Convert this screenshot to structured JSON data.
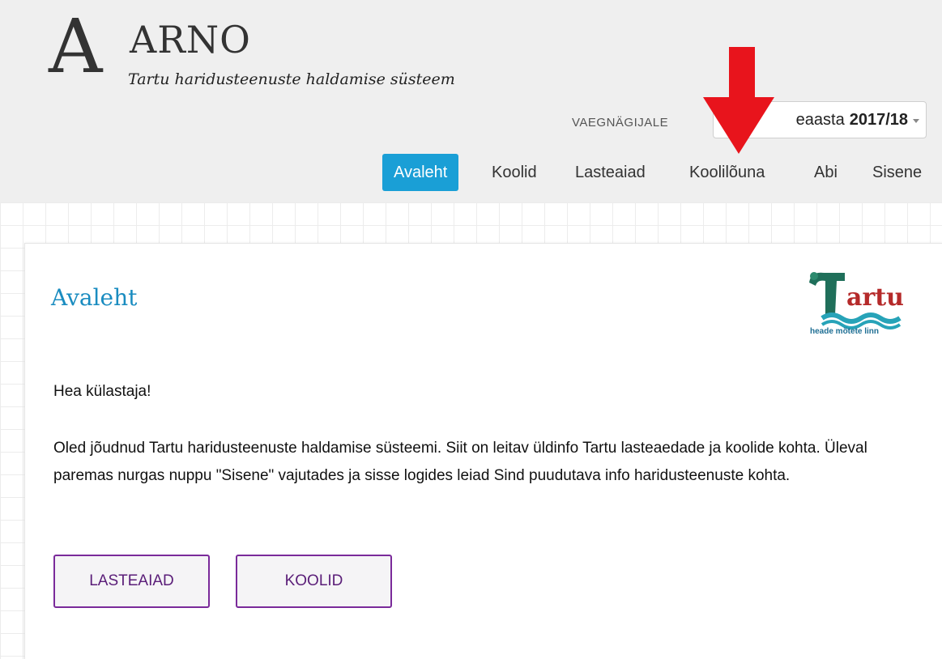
{
  "brand": {
    "letter": "A",
    "name": "ARNO",
    "subtitle": "Tartu haridusteenuste haldamise süsteem"
  },
  "header": {
    "view_link": "VAEGNÄGIJALE",
    "year_select": {
      "prefix": "eaasta",
      "value": "2017/18"
    }
  },
  "nav": {
    "items": [
      {
        "label": "Avaleht",
        "active": true
      },
      {
        "label": "Koolid"
      },
      {
        "label": "Lasteaiad"
      },
      {
        "label": "Koolilõuna"
      },
      {
        "label": "Abi"
      },
      {
        "label": "Sisene"
      }
    ]
  },
  "annotation": {
    "color": "#e8141c"
  },
  "main": {
    "title": "Avaleht",
    "logo": {
      "brand": "Tartu",
      "tagline": "heade mõtete linn"
    },
    "greeting": "Hea külastaja!",
    "intro": "Oled jõudnud Tartu haridusteenuste haldamise süsteemi. Siit on leitav üldinfo Tartu lasteaedade ja koolide kohta. Üleval paremas nurgas nuppu \"Sisene\" vajutades ja sisse logides leiad Sind puudutava info haridusteenuste kohta.",
    "buttons": {
      "lasteaiad": "LASTEAIAD",
      "koolid": "KOOLID"
    }
  },
  "colors": {
    "accent": "#1a9fd6",
    "title": "#1a8cc0",
    "button_border": "#7a2a9a"
  }
}
